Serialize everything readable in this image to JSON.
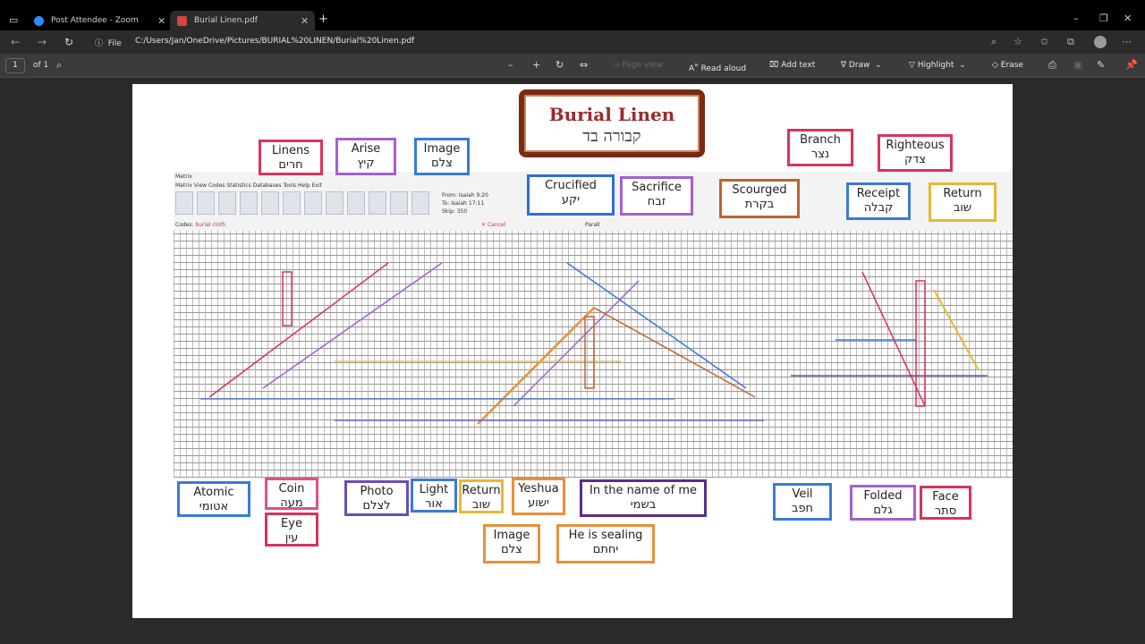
{
  "browser": {
    "tabs": [
      {
        "label": "Post Attendee - Zoom",
        "icon_color": "#2d8cff"
      },
      {
        "label": "Burial Linen.pdf",
        "icon_color": "#d64541"
      }
    ],
    "new_tab": "+",
    "window_controls": [
      "–",
      "❐",
      "✕"
    ],
    "address": {
      "file_label": "File",
      "url": "C:/Users/Jan/OneDrive/Pictures/BURIAL%20LINEN/Burial%20Linen.pdf"
    }
  },
  "pdf_toolbar": {
    "page_number": "1",
    "page_count": "of 1",
    "zoom_out": "–",
    "zoom_in": "+",
    "page_view": "Page view",
    "read_aloud": "Read aloud",
    "add_text": "Add text",
    "draw": "Draw",
    "highlight": "Highlight",
    "erase": "Erase"
  },
  "document": {
    "title_en": "Burial Linen",
    "title_he": "קבורה בד",
    "labels": [
      {
        "id": "linens",
        "en": "Linens",
        "he": "חרים",
        "color": "#d9335a"
      },
      {
        "id": "arise",
        "en": "Arise",
        "he": "קיץ",
        "color": "#a45fd1"
      },
      {
        "id": "image-top",
        "en": "Image",
        "he": "צלם",
        "color": "#3a7bd5"
      },
      {
        "id": "branch",
        "en": "Branch",
        "he": "נצר",
        "color": "#d9335a"
      },
      {
        "id": "righteous",
        "en": "Righteous",
        "he": "צדק",
        "color": "#d9335a"
      },
      {
        "id": "crucified",
        "en": "Crucified",
        "he": "יקע",
        "color": "#2f6fd6"
      },
      {
        "id": "sacrifice",
        "en": "Sacrifice",
        "he": "זבח",
        "color": "#a45fd1"
      },
      {
        "id": "scourged",
        "en": "Scourged",
        "he": "בקרת",
        "color": "#c0622f"
      },
      {
        "id": "receipt",
        "en": "Receipt",
        "he": "קבלה",
        "color": "#3a7bd5"
      },
      {
        "id": "return-top",
        "en": "Return",
        "he": "שוב",
        "color": "#e8b830"
      },
      {
        "id": "atomic",
        "en": "Atomic",
        "he": "אטומי",
        "color": "#3a7bd5"
      },
      {
        "id": "coin",
        "en": "Coin",
        "he": "מעה",
        "color": "#e0508a"
      },
      {
        "id": "eye",
        "en": "Eye",
        "he": "עין",
        "color": "#d9335a"
      },
      {
        "id": "photo",
        "en": "Photo",
        "he": "לצלם",
        "color": "#6a4fb0"
      },
      {
        "id": "light",
        "en": "Light",
        "he": "אור",
        "color": "#3a7bd5"
      },
      {
        "id": "return-bottom",
        "en": "Return",
        "he": "שוב",
        "color": "#e8b830"
      },
      {
        "id": "yeshua",
        "en": "Yeshua",
        "he": "ישוע",
        "color": "#e8903a"
      },
      {
        "id": "name",
        "en": "In the name of me",
        "he": "בשמי",
        "color": "#5a2f8a"
      },
      {
        "id": "image-bottom",
        "en": "Image",
        "he": "צלם",
        "color": "#e8903a"
      },
      {
        "id": "sealing",
        "en": "He is sealing",
        "he": "יחתם",
        "color": "#e8903a"
      },
      {
        "id": "veil",
        "en": "Veil",
        "he": "חפב",
        "color": "#3a7bd5"
      },
      {
        "id": "folded",
        "en": "Folded",
        "he": "גלם",
        "color": "#a45fd1"
      },
      {
        "id": "face",
        "en": "Face",
        "he": "סתר",
        "color": "#d9335a"
      }
    ],
    "matrix": {
      "title": "Matrix",
      "menu": "Matrix  View  Codes  Statistics  Databases  Tools  Help  Exit",
      "from_label": "From:",
      "from_value": "Isaiah 9:20",
      "to_label": "To:",
      "to_value": "Isaiah 17:11",
      "skip_label": "Skip:",
      "skip_value": "350",
      "codes_label": "Codes:",
      "codes_value": "burial cloth",
      "cancel": "Cancel",
      "panel_label": "Parall"
    }
  }
}
